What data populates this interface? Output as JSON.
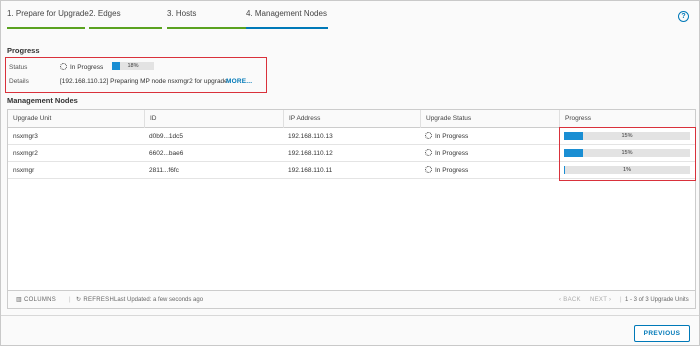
{
  "stepper": {
    "steps": [
      {
        "label": "1. Prepare for Upgrade"
      },
      {
        "label": "2. Edges"
      },
      {
        "label": "3. Hosts"
      },
      {
        "label": "4. Management Nodes"
      }
    ],
    "colors": {
      "done": "#5aa220",
      "active": "#0079b8"
    }
  },
  "help_icon": "?",
  "progress": {
    "title": "Progress",
    "status_label": "Status",
    "status_value": "In Progress",
    "status_percent_text": "18%",
    "status_percent": 18,
    "details_label": "Details",
    "details_value": "[192.168.110.12] Preparing MP node nsxmgr2 for upgrade",
    "more_link": "MORE..."
  },
  "nodes": {
    "title": "Management Nodes",
    "columns": [
      "Upgrade Unit",
      "ID",
      "IP Address",
      "Upgrade Status",
      "Progress"
    ],
    "rows": [
      {
        "unit": "nsxmgr3",
        "id": "d0b9...1dc5",
        "ip": "192.168.110.13",
        "status": "In Progress",
        "progress_text": "15%",
        "progress": 15
      },
      {
        "unit": "nsxmgr2",
        "id": "6602...bae6",
        "ip": "192.168.110.12",
        "status": "In Progress",
        "progress_text": "15%",
        "progress": 15
      },
      {
        "unit": "nsxmgr",
        "id": "2811...f6fc",
        "ip": "192.168.110.11",
        "status": "In Progress",
        "progress_text": "1%",
        "progress": 1
      }
    ],
    "footer": {
      "columns_label": "COLUMNS",
      "refresh_label": "REFRESH",
      "last_updated": "Last Updated: a few seconds ago",
      "back_label": "‹ BACK",
      "next_label": "NEXT ›",
      "count_text": "1 - 3 of 3 Upgrade Units"
    }
  },
  "previous_button": "PREVIOUS",
  "colors": {
    "accent": "#0079b8",
    "progress_fill": "#1a8ed3",
    "highlight": "#d9313b"
  }
}
